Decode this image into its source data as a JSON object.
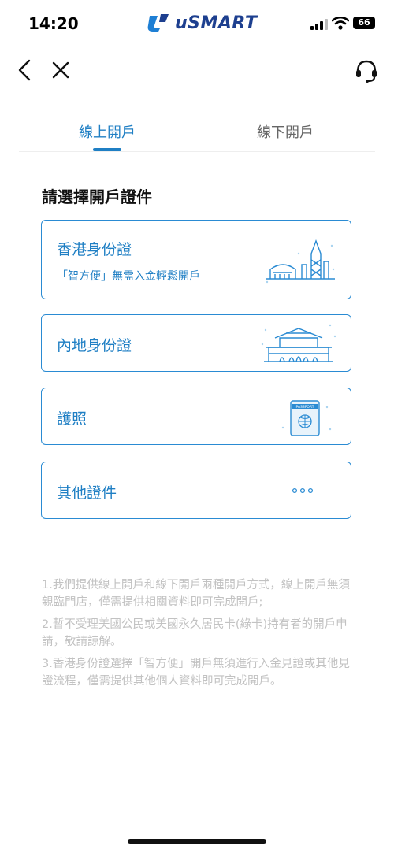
{
  "status_bar": {
    "time": "14:20",
    "battery": "66",
    "logo_text": "uSMART"
  },
  "tabs": [
    {
      "label": "線上開戶",
      "active": true
    },
    {
      "label": "線下開戶",
      "active": false
    }
  ],
  "section_title": "請選擇開戶證件",
  "cards": [
    {
      "title": "香港身份證",
      "subtitle": "「智方便」無需入金輕鬆開戶",
      "icon": "hong-kong-skyline-icon"
    },
    {
      "title": "內地身份證",
      "icon": "tiananmen-gate-icon"
    },
    {
      "title": "護照",
      "icon": "passport-icon"
    },
    {
      "title": "其他證件",
      "icon": "more-dots-icon"
    }
  ],
  "notes": [
    "1.我們提供線上開戶和線下開戶兩種開戶方式，線上開戶無須親臨門店，僅需提供相關資料即可完成開戶;",
    "2.暫不受理美國公民或美國永久居民卡(綠卡)持有者的開戶申請，敬請諒解。",
    "3.香港身份證選擇「智方便」開戶無須進行入金見證或其他見證流程，僅需提供其他個人資料即可完成開戶。"
  ],
  "colors": {
    "accent": "#1f7fc4",
    "note_text": "#c2c2c2"
  }
}
